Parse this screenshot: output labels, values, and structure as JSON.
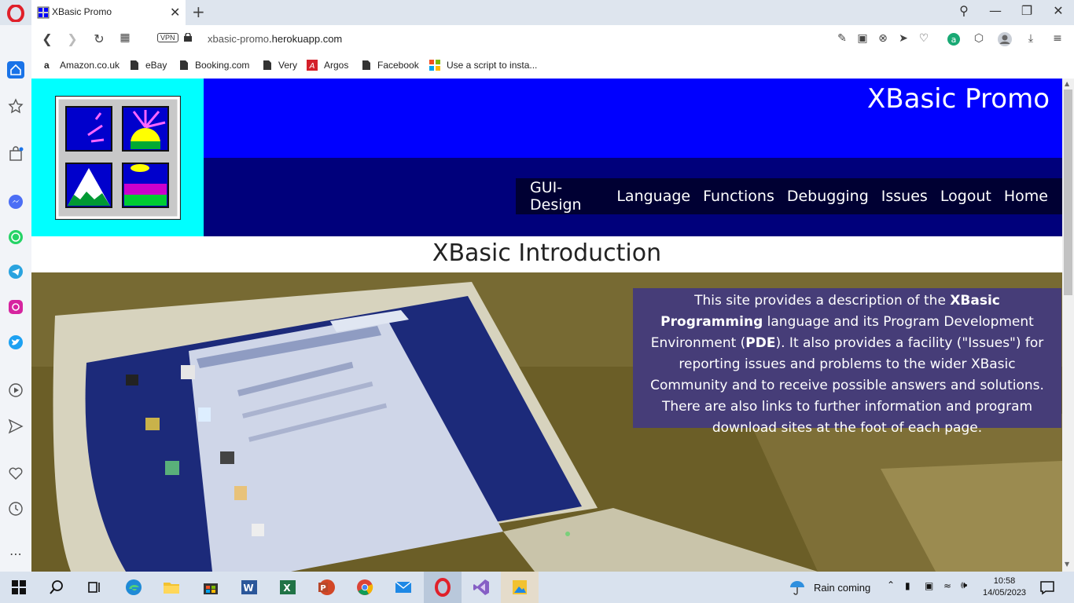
{
  "browser": {
    "tab_title": "XBasic Promo",
    "url_domain": "xbasic-promo",
    "url_rest": ".herokuapp.com",
    "vpn_label": "VPN",
    "bookmarks": [
      "Amazon.co.uk",
      "eBay",
      "Booking.com",
      "Very",
      "Argos",
      "Facebook",
      "Use a script to insta..."
    ]
  },
  "site": {
    "title": "XBasic Promo",
    "menu": [
      "GUI-Design",
      "Language",
      "Functions",
      "Debugging",
      "Issues",
      "Logout",
      "Home"
    ],
    "heading": "XBasic Introduction",
    "intro_1": "This site provides a description of the ",
    "intro_bold_1": "XBasic Programming",
    "intro_2": " language and its Program Development Environment (",
    "intro_bold_2": "PDE",
    "intro_3": "). It also provides a facility (\"Issues\") for reporting issues and problems to the wider XBasic Community and to receive possible answers and solutions. There are also links to further information and program download sites at the foot of each page."
  },
  "taskbar": {
    "weather": "Rain coming",
    "time": "10:58",
    "date": "14/05/2023"
  },
  "colors": {
    "logo_bg": "#00ffff",
    "header_blue": "#0000ff",
    "nav_navy": "#00007b",
    "menu_bg": "#000033",
    "intro_bg": "#463d78"
  }
}
